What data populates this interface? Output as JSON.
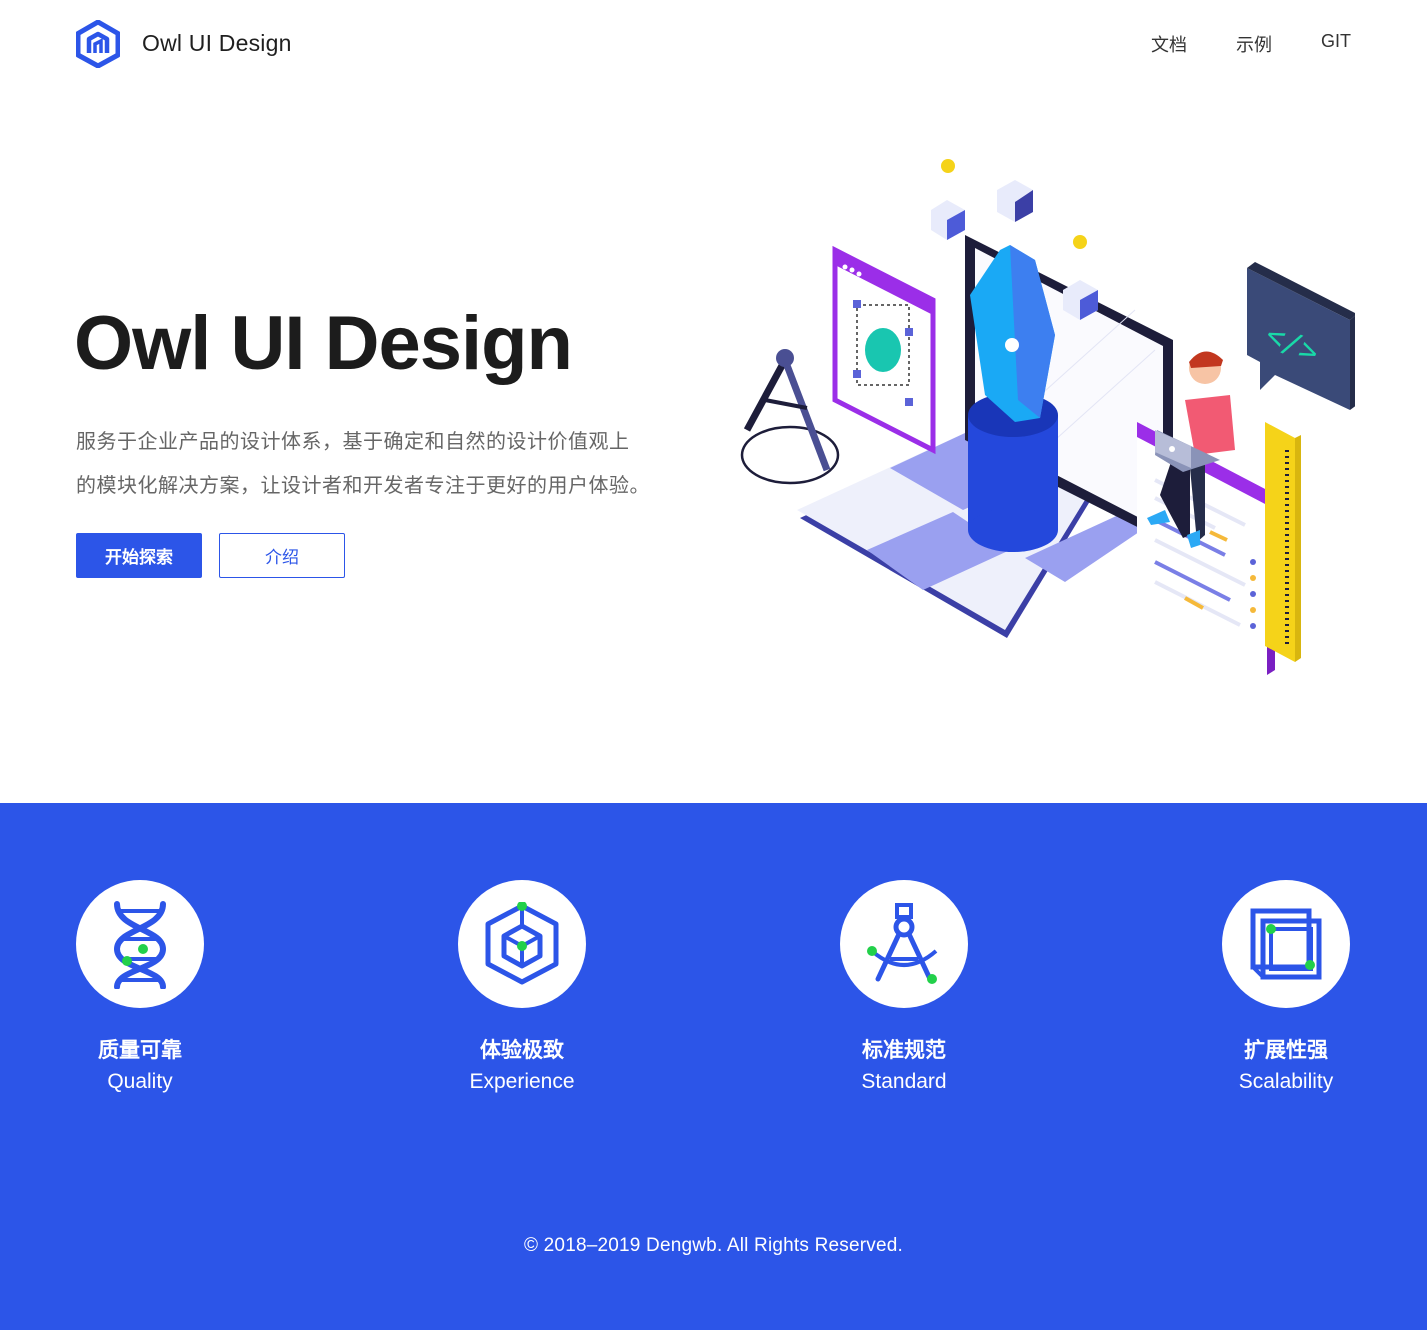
{
  "header": {
    "brand": "Owl UI Design",
    "nav": [
      "文档",
      "示例",
      "GIT"
    ]
  },
  "hero": {
    "title": "Owl UI Design",
    "desc_line1": "服务于企业产品的设计体系，基于确定和自然的设计价值观上",
    "desc_line2": "的模块化解决方案，让设计者和开发者专注于更好的用户体验。",
    "primary_button": "开始探索",
    "secondary_button": "介绍"
  },
  "features": [
    {
      "zh": "质量可靠",
      "en": "Quality",
      "icon": "dna-icon"
    },
    {
      "zh": "体验极致",
      "en": "Experience",
      "icon": "cube-icon"
    },
    {
      "zh": "标准规范",
      "en": "Standard",
      "icon": "compass-icon"
    },
    {
      "zh": "扩展性强",
      "en": "Scalability",
      "icon": "layers-icon"
    }
  ],
  "footer": {
    "copyright": "© 2018–2019 Dengwb. All Rights Reserved."
  },
  "colors": {
    "primary": "#2c55e8",
    "accent_green": "#22d04a",
    "text_dark": "#1c1c1c",
    "text_muted": "#666666"
  }
}
